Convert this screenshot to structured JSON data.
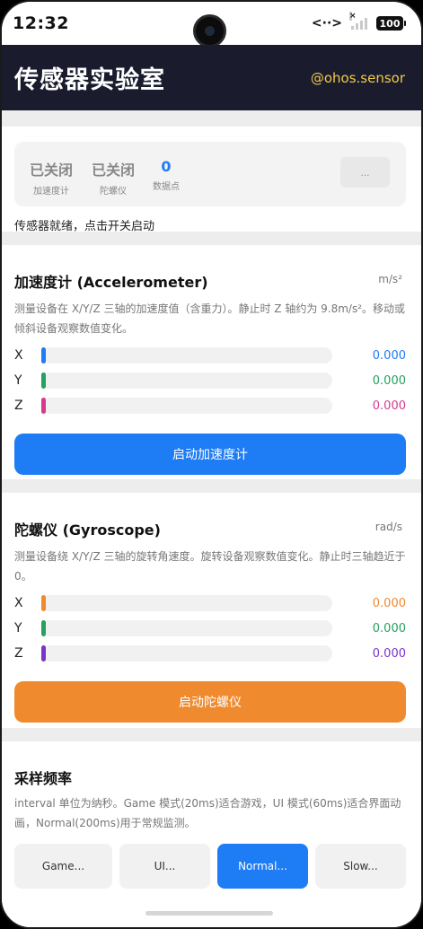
{
  "status_bar": {
    "time": "12:32",
    "battery": "100"
  },
  "app_bar": {
    "title": "传感器实验室",
    "handle": "@ohos.sensor"
  },
  "status_card": {
    "stats": [
      {
        "value": "已关闭",
        "label": "加速度计"
      },
      {
        "value": "已关闭",
        "label": "陀螺仪"
      },
      {
        "value": "0",
        "label": "数据点"
      }
    ],
    "more_label": "...",
    "ready_text": "传感器就绪，点击开关启动"
  },
  "accelerometer": {
    "title": "加速度计 (Accelerometer)",
    "unit": "m/s²",
    "description": "测量设备在 X/Y/Z 三轴的加速度值（含重力）。静止时 Z 轴约为 9.8m/s²。移动或倾斜设备观察数值变化。",
    "axes": [
      {
        "name": "X",
        "value": "0.000",
        "color": "#1e7cf5"
      },
      {
        "name": "Y",
        "value": "0.000",
        "color": "#27a060"
      },
      {
        "name": "Z",
        "value": "0.000",
        "color": "#d63a8c"
      }
    ],
    "button_label": "启动加速度计",
    "button_color": "#1e7cf5"
  },
  "gyroscope": {
    "title": "陀螺仪 (Gyroscope)",
    "unit": "rad/s",
    "description": "测量设备绕 X/Y/Z 三轴的旋转角速度。旋转设备观察数值变化。静止时三轴趋近于 0。",
    "axes": [
      {
        "name": "X",
        "value": "0.000",
        "color": "#ef8a2e"
      },
      {
        "name": "Y",
        "value": "0.000",
        "color": "#27a060"
      },
      {
        "name": "Z",
        "value": "0.000",
        "color": "#7a34c9"
      }
    ],
    "button_label": "启动陀螺仪",
    "button_color": "#ef8a2e"
  },
  "sampling": {
    "title": "采样频率",
    "description": "interval 单位为纳秒。Game 模式(20ms)适合游戏，UI 模式(60ms)适合界面动画，Normal(200ms)用于常规监测。",
    "options": [
      "Game...",
      "UI...",
      "Normal...",
      "Slow..."
    ],
    "selected": "Normal..."
  }
}
